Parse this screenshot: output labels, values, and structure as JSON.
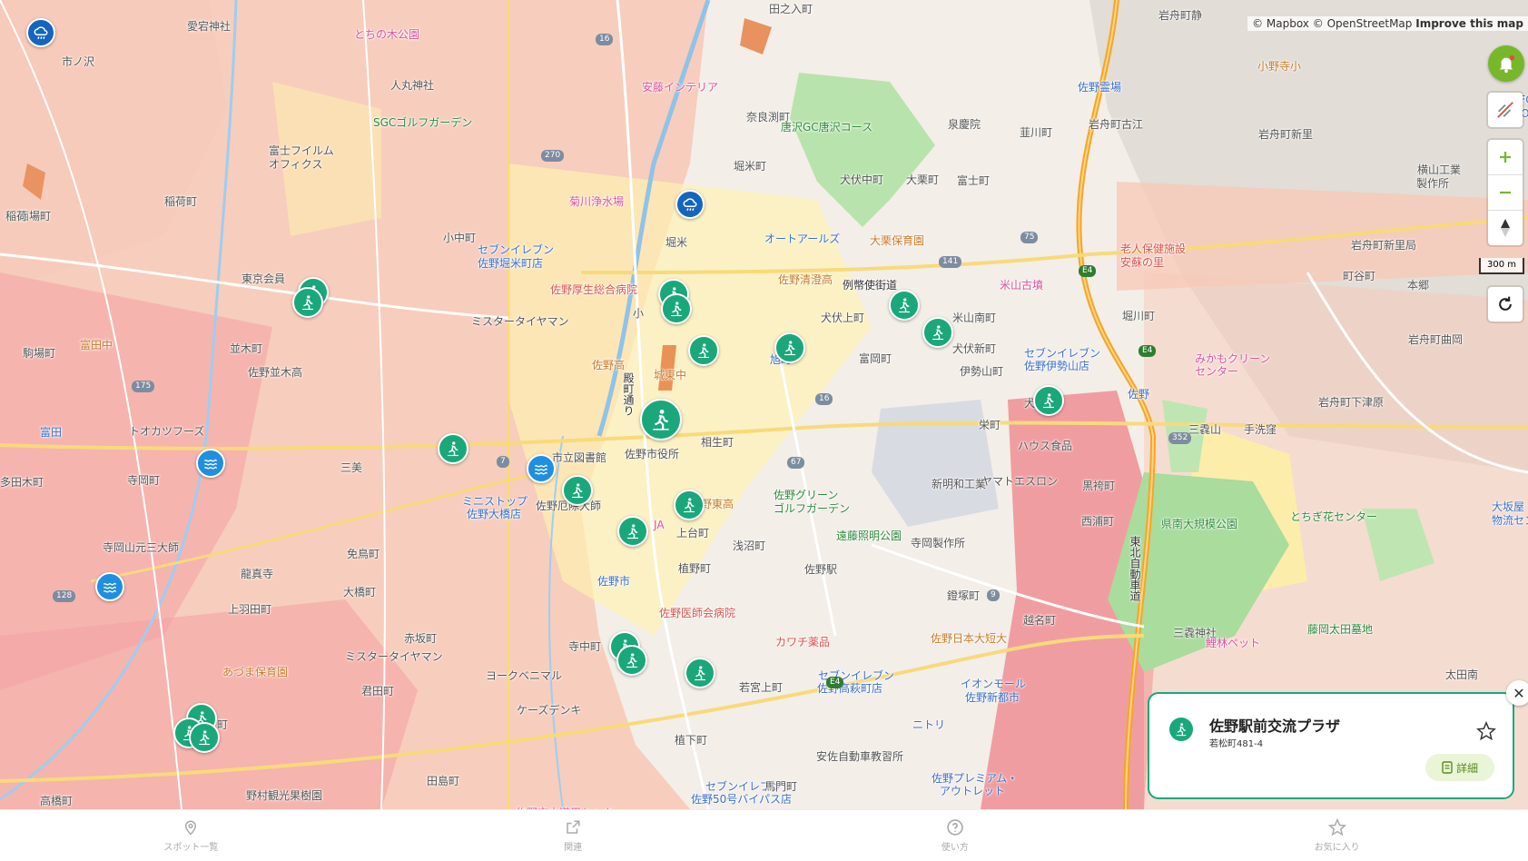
{
  "attribution": {
    "mapbox": "© Mapbox",
    "osm": "© OpenStreetMap",
    "improve": "Improve this map"
  },
  "scale_label": "300 m",
  "colors": {
    "marker": "#1aa87a",
    "accent": "#76b82a",
    "water": "#1f8fe0"
  },
  "labels": [
    {
      "text": "愛宕神社",
      "cls": ""
    },
    {
      "text": "とちの木公園",
      "cls": "poi-pink"
    },
    {
      "text": "市ノ沢",
      "cls": ""
    },
    {
      "text": "人丸神社",
      "cls": ""
    },
    {
      "text": "SGCゴルフガーデン",
      "cls": "poi-green"
    },
    {
      "text": "富士フイルム",
      "cls": ""
    },
    {
      "text": "オフィクス",
      "cls": ""
    },
    {
      "text": "安藤インテリア",
      "cls": "poi-pink"
    },
    {
      "text": "奈良渕町",
      "cls": ""
    },
    {
      "text": "堀米町",
      "cls": ""
    },
    {
      "text": "菊川浄水場",
      "cls": "poi-pink"
    },
    {
      "text": "稲荷町",
      "cls": ""
    },
    {
      "text": "西場町",
      "cls": ""
    },
    {
      "text": "小中町",
      "cls": ""
    },
    {
      "text": "東京会員",
      "cls": ""
    },
    {
      "text": "セブンイレブン",
      "cls": "poi-blue"
    },
    {
      "text": "佐野堀米町店",
      "cls": "poi-blue"
    },
    {
      "text": "佐野厚生総合病院",
      "cls": "poi-red"
    },
    {
      "text": "ミスタータイヤマン",
      "cls": ""
    },
    {
      "text": "駒場町",
      "cls": ""
    },
    {
      "text": "富田中",
      "cls": "poi-orange"
    },
    {
      "text": "並木町",
      "cls": ""
    },
    {
      "text": "佐野並木高",
      "cls": ""
    },
    {
      "text": "佐野高",
      "cls": "poi-orange"
    },
    {
      "text": "城東中",
      "cls": "poi-orange"
    },
    {
      "text": "殿町通り",
      "cls": "road"
    },
    {
      "text": "富田",
      "cls": "poi-blue"
    },
    {
      "text": "トオカツフーズ",
      "cls": ""
    },
    {
      "text": "寺岡町",
      "cls": ""
    },
    {
      "text": "多田木町",
      "cls": ""
    },
    {
      "text": "三美",
      "cls": ""
    },
    {
      "text": "市立図書館",
      "cls": ""
    },
    {
      "text": "佐野市役所",
      "cls": ""
    },
    {
      "text": "相生町",
      "cls": ""
    },
    {
      "text": "ミニストップ",
      "cls": "poi-blue"
    },
    {
      "text": "佐野大橋店",
      "cls": "poi-blue"
    },
    {
      "text": "佐野厄除大師",
      "cls": ""
    },
    {
      "text": "佐野東高",
      "cls": "poi-orange"
    },
    {
      "text": "寺岡山元三大師",
      "cls": ""
    },
    {
      "text": "龍真寺",
      "cls": ""
    },
    {
      "text": "免鳥町",
      "cls": ""
    },
    {
      "text": "上台町",
      "cls": ""
    },
    {
      "text": "植野町",
      "cls": ""
    },
    {
      "text": "浅沼町",
      "cls": ""
    },
    {
      "text": "佐野市",
      "cls": "poi-blue"
    },
    {
      "text": "大橋町",
      "cls": ""
    },
    {
      "text": "上羽田町",
      "cls": ""
    },
    {
      "text": "赤坂町",
      "cls": ""
    },
    {
      "text": "ミスタータイヤマン",
      "cls": ""
    },
    {
      "text": "佐野医師会病院",
      "cls": "poi-red"
    },
    {
      "text": "あづま保育園",
      "cls": "poi-orange"
    },
    {
      "text": "寺中町",
      "cls": ""
    },
    {
      "text": "ヨークベニマル",
      "cls": ""
    },
    {
      "text": "君田町",
      "cls": ""
    },
    {
      "text": "ケーズデンキ",
      "cls": ""
    },
    {
      "text": "田島町",
      "cls": ""
    },
    {
      "text": "植下町",
      "cls": ""
    },
    {
      "text": "若宮上町",
      "cls": ""
    },
    {
      "text": "野村観光果樹園",
      "cls": ""
    },
    {
      "text": "高橋町",
      "cls": ""
    },
    {
      "text": "セブンイレブン",
      "cls": "poi-blue"
    },
    {
      "text": "佐野50号バイパス店",
      "cls": "poi-blue"
    },
    {
      "text": "馬門町",
      "cls": ""
    },
    {
      "text": "田之入町",
      "cls": ""
    },
    {
      "text": "唐沢GC唐沢コース",
      "cls": "poi-green"
    },
    {
      "text": "泉慶院",
      "cls": ""
    },
    {
      "text": "韮川町",
      "cls": ""
    },
    {
      "text": "犬伏中町",
      "cls": ""
    },
    {
      "text": "大栗町",
      "cls": ""
    },
    {
      "text": "富士町",
      "cls": ""
    },
    {
      "text": "オートアールズ",
      "cls": "poi-blue"
    },
    {
      "text": "大栗保育園",
      "cls": "poi-orange"
    },
    {
      "text": "佐野清澄高",
      "cls": "poi-orange"
    },
    {
      "text": "例幣使街道",
      "cls": "road"
    },
    {
      "text": "犬伏上町",
      "cls": ""
    },
    {
      "text": "米山古墳",
      "cls": "poi-pink"
    },
    {
      "text": "米山南町",
      "cls": ""
    },
    {
      "text": "犬伏新町",
      "cls": ""
    },
    {
      "text": "旭町",
      "cls": "poi-blue"
    },
    {
      "text": "富岡町",
      "cls": ""
    },
    {
      "text": "伊勢山町",
      "cls": ""
    },
    {
      "text": "セブンイレブン",
      "cls": "poi-blue"
    },
    {
      "text": "佐野伊勢山店",
      "cls": "poi-blue"
    },
    {
      "text": "栄町",
      "cls": ""
    },
    {
      "text": "ハウス食品",
      "cls": ""
    },
    {
      "text": "新明和工業",
      "cls": ""
    },
    {
      "text": "ヤマトエスロン",
      "cls": ""
    },
    {
      "text": "佐野グリーン",
      "cls": "poi-green"
    },
    {
      "text": "ゴルフガーデン",
      "cls": "poi-green"
    },
    {
      "text": "遠藤照明公園",
      "cls": "poi-green"
    },
    {
      "text": "寺岡製作所",
      "cls": ""
    },
    {
      "text": "佐野駅",
      "cls": ""
    },
    {
      "text": "鐙塚町",
      "cls": ""
    },
    {
      "text": "カワチ薬品",
      "cls": "poi-red"
    },
    {
      "text": "佐野日本大短大",
      "cls": "poi-orange"
    },
    {
      "text": "セブンイレブン",
      "cls": "poi-blue"
    },
    {
      "text": "佐野高萩町店",
      "cls": "poi-blue"
    },
    {
      "text": "イオンモール",
      "cls": "poi-blue"
    },
    {
      "text": "佐野新都市",
      "cls": "poi-blue"
    },
    {
      "text": "ニトリ",
      "cls": "poi-blue"
    },
    {
      "text": "安佐自動車教習所",
      "cls": ""
    },
    {
      "text": "佐野プレミアム・",
      "cls": "poi-blue"
    },
    {
      "text": "アウトレット",
      "cls": "poi-blue"
    },
    {
      "text": "越名町",
      "cls": ""
    },
    {
      "text": "西浦町",
      "cls": ""
    },
    {
      "text": "黒袴町",
      "cls": ""
    },
    {
      "text": "堀川町",
      "cls": ""
    },
    {
      "text": "岩舟町静",
      "cls": ""
    },
    {
      "text": "岩舟町古江",
      "cls": ""
    },
    {
      "text": "佐野霊場",
      "cls": "poi-blue"
    },
    {
      "text": "小野寺小",
      "cls": "poi-orange"
    },
    {
      "text": "岩舟町新里",
      "cls": ""
    },
    {
      "text": "横山工業",
      "cls": ""
    },
    {
      "text": "製作所",
      "cls": ""
    },
    {
      "text": "岩舟町新里局",
      "cls": ""
    },
    {
      "text": "老人保健施設",
      "cls": "poi-red"
    },
    {
      "text": "安蘇の里",
      "cls": "poi-red"
    },
    {
      "text": "町谷町",
      "cls": ""
    },
    {
      "text": "本郷",
      "cls": ""
    },
    {
      "text": "みかもクリーン",
      "cls": "poi-pink"
    },
    {
      "text": "センター",
      "cls": "poi-pink"
    },
    {
      "text": "岩舟町曲岡",
      "cls": ""
    },
    {
      "text": "佐野",
      "cls": "poi-blue"
    },
    {
      "text": "三毳山",
      "cls": ""
    },
    {
      "text": "手洗窪",
      "cls": ""
    },
    {
      "text": "岩舟町下津原",
      "cls": ""
    },
    {
      "text": "県南大規模公園",
      "cls": "poi-green"
    },
    {
      "text": "とちぎ花センター",
      "cls": "poi-green"
    },
    {
      "text": "三毳神社",
      "cls": ""
    },
    {
      "text": "藤岡太田墓地",
      "cls": "poi-green"
    },
    {
      "text": "鯉林ペット",
      "cls": "poi-pink"
    },
    {
      "text": "太田南",
      "cls": ""
    },
    {
      "text": "東北自動車道",
      "cls": "road"
    },
    {
      "text": "CITY FOOT",
      "cls": "poi-blue"
    },
    {
      "text": "STATION",
      "cls": "poi-blue"
    },
    {
      "text": "大坂屋",
      "cls": "poi-blue"
    },
    {
      "text": "物流セン",
      "cls": "poi-blue"
    },
    {
      "text": "JA",
      "cls": "poi-pink"
    },
    {
      "text": "堀米",
      "cls": ""
    },
    {
      "text": "犬",
      "cls": ""
    },
    {
      "text": "町",
      "cls": ""
    },
    {
      "text": "小",
      "cls": ""
    },
    {
      "text": "稲荷",
      "cls": ""
    },
    {
      "text": "佐野市水道用センター",
      "cls": "poi-pink"
    }
  ],
  "road_numbers": [
    "16",
    "270",
    "175",
    "7",
    "128",
    "16",
    "67",
    "141",
    "75",
    "E4",
    "E4",
    "352",
    "9",
    "E4"
  ],
  "card": {
    "title": "佐野駅前交流プラザ",
    "address": "若松町481-4",
    "detail_label": "詳細"
  },
  "nav": [
    {
      "label": "スポット一覧",
      "icon": "pin-icon"
    },
    {
      "label": "関連",
      "icon": "external-link-icon"
    },
    {
      "label": "使い方",
      "icon": "help-icon"
    },
    {
      "label": "お気に入り",
      "icon": "star-icon"
    }
  ]
}
